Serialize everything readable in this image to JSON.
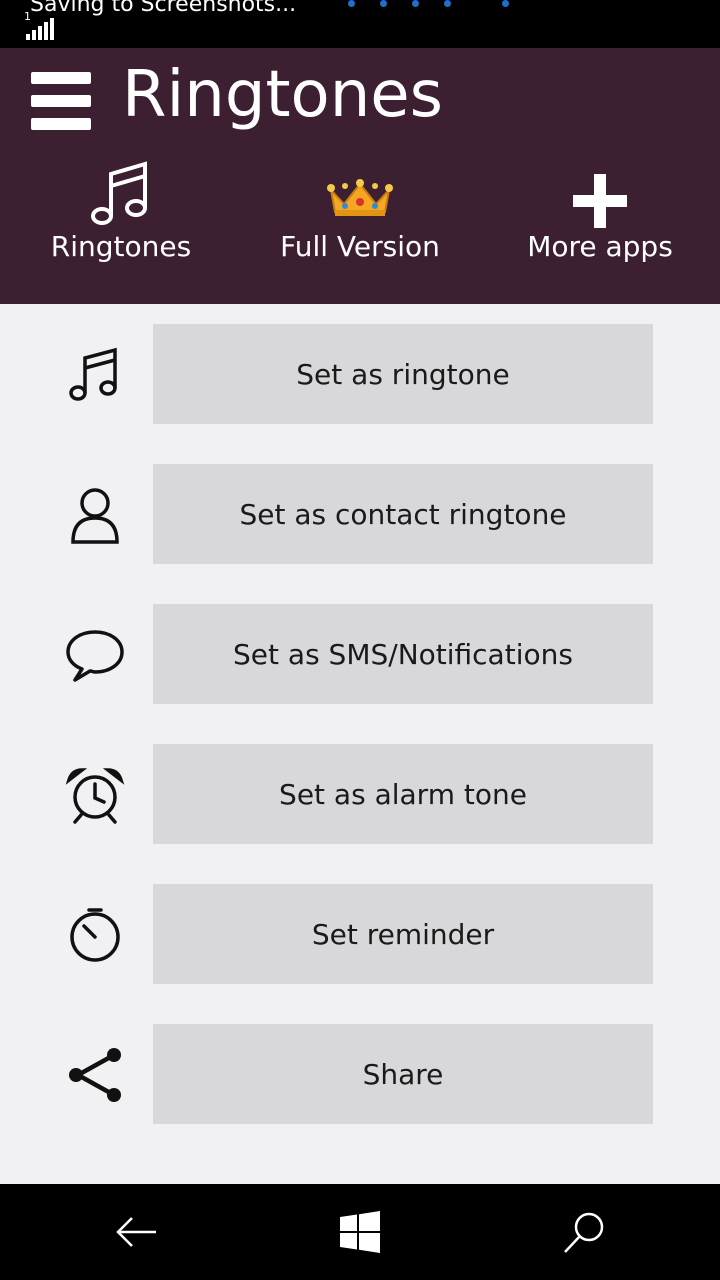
{
  "status_bar": {
    "notification": "Saving to Screenshots...",
    "sim": "1",
    "dot_color": "#1f6fd1"
  },
  "header": {
    "title": "Ringtones",
    "background": "#3d1f32",
    "nav": [
      {
        "label": "Ringtones",
        "icon": "music-notes-icon"
      },
      {
        "label": "Full Version",
        "icon": "crown-icon"
      },
      {
        "label": "More apps",
        "icon": "plus-icon"
      }
    ]
  },
  "actions": [
    {
      "label": "Set as ringtone",
      "icon": "music-notes-icon"
    },
    {
      "label": "Set as contact ringtone",
      "icon": "person-icon"
    },
    {
      "label": "Set as SMS/Notifications",
      "icon": "chat-bubble-icon"
    },
    {
      "label": "Set as alarm tone",
      "icon": "alarm-clock-icon"
    },
    {
      "label": "Set reminder",
      "icon": "timer-icon"
    },
    {
      "label": "Share",
      "icon": "share-icon"
    }
  ],
  "system_nav": {
    "icons": [
      "back-arrow-icon",
      "windows-logo-icon",
      "search-icon"
    ]
  }
}
